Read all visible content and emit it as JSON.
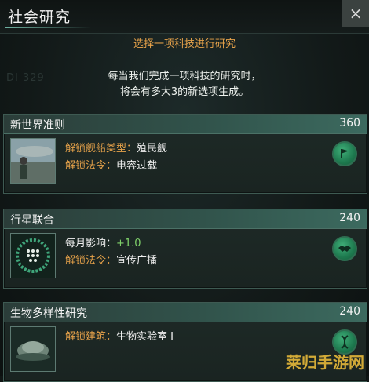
{
  "window": {
    "title": "社会研究",
    "close_glyph": "×"
  },
  "background_text": "DI 329",
  "header": {
    "subtitle": "选择一项科技进行研究",
    "description_line1": "每当我们完成一项科技的研究时，",
    "description_line2": "将会有多大3的新选项生成。"
  },
  "options": [
    {
      "name": "新世界准则",
      "cost": "360",
      "icon": "flag-icon",
      "lines": [
        {
          "label": "解锁舰船类型：",
          "value": "殖民舰"
        },
        {
          "label": "解锁法令：",
          "value": "电容过载"
        }
      ]
    },
    {
      "name": "行星联合",
      "cost": "240",
      "icon": "handshake-icon",
      "lines": [
        {
          "label": "每月影响：",
          "value": "+1.0"
        },
        {
          "label": "解锁法令：",
          "value": "宣传广播"
        }
      ]
    },
    {
      "name": "生物多样性研究",
      "cost": "240",
      "icon": "dna-icon",
      "lines": [
        {
          "label": "解锁建筑：",
          "value": "生物实验室 I"
        }
      ]
    }
  ],
  "watermark": "莱归手游网",
  "colors": {
    "accent_orange": "#e6a24a",
    "positive_green": "#7fd16a",
    "badge_green": "#2f9e6a"
  }
}
